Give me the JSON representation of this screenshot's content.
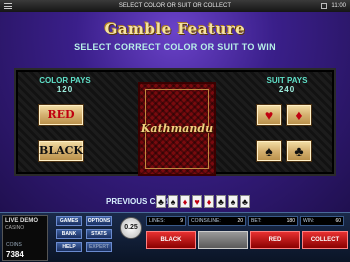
{
  "titlebar": {
    "message": "SELECT COLOR OR SUIT OR COLLECT",
    "clock": "11:00"
  },
  "game": {
    "title": "Gamble Feature",
    "instruction": "SELECT CORRECT COLOR OR SUIT TO WIN",
    "color_pays": {
      "label": "COLOR PAYS",
      "amount": "120"
    },
    "suit_pays": {
      "label": "SUIT PAYS",
      "amount": "240"
    },
    "color_buttons": [
      "RED",
      "BLACK"
    ],
    "card_logo": "Kathmandu",
    "suit_buttons": [
      {
        "icon": "heart-icon",
        "glyph": "♥",
        "color": "#c00010"
      },
      {
        "icon": "diamond-icon",
        "glyph": "♦",
        "color": "#c00010"
      },
      {
        "icon": "spade-icon",
        "glyph": "♠",
        "color": "#111111"
      },
      {
        "icon": "club-icon",
        "glyph": "♣",
        "color": "#111111"
      }
    ],
    "previous_cards_label": "PREVIOUS CARDS",
    "previous_cards": [
      {
        "icon": "club-icon",
        "glyph": "♣",
        "color": "#111111"
      },
      {
        "icon": "spade-icon",
        "glyph": "♠",
        "color": "#111111"
      },
      {
        "icon": "diamond-icon",
        "glyph": "♦",
        "color": "#c00010"
      },
      {
        "icon": "heart-icon",
        "glyph": "♥",
        "color": "#c00010"
      },
      {
        "icon": "diamond-icon",
        "glyph": "♦",
        "color": "#c00010"
      },
      {
        "icon": "club-icon",
        "glyph": "♣",
        "color": "#111111"
      },
      {
        "icon": "spade-icon",
        "glyph": "♠",
        "color": "#111111"
      },
      {
        "icon": "club-icon",
        "glyph": "♣",
        "color": "#111111"
      }
    ]
  },
  "console": {
    "brand": "LIVE DEMO",
    "brand_sub": "CASINO",
    "coins_label": "COINS",
    "coins_value": "7384",
    "buttons": {
      "games": "GAMES",
      "options": "OPTIONS",
      "bank": "BANK",
      "stats": "STATS",
      "help": "HELP",
      "expert": "EXPERT"
    },
    "coin_size": "0.25",
    "info": {
      "lines_label": "LINES:",
      "lines_value": "9",
      "coins_line_label": "COINS/LINE:",
      "coins_line_value": "20",
      "bet_label": "BET:",
      "bet_value": "180",
      "win_label": "WIN:",
      "win_value": "60"
    },
    "actions": {
      "black": "BLACK",
      "red": "RED",
      "collect": "COLLECT"
    }
  }
}
